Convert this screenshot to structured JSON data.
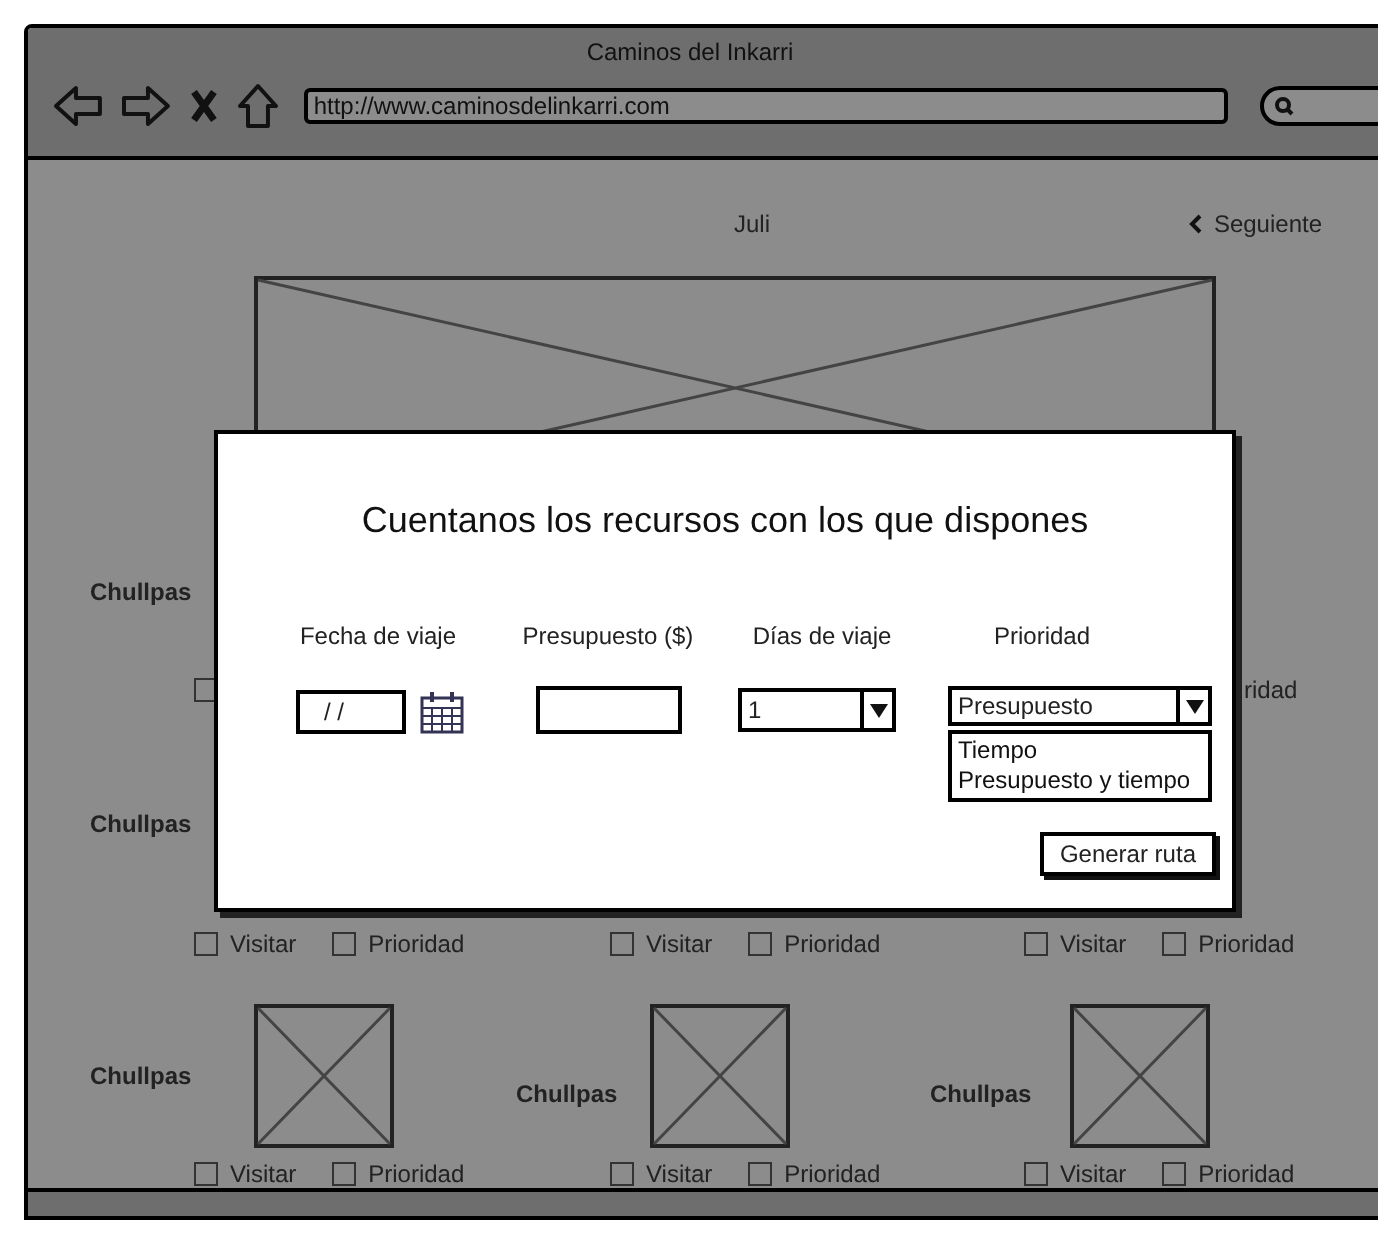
{
  "browser": {
    "title": "Caminos del Inkarri",
    "url": "http://www.caminosdelinkarri.com"
  },
  "header": {
    "month": "Juli",
    "next": "Seguiente"
  },
  "row_1": {
    "label": "Chullpas",
    "checkbox": {
      "checked": false
    },
    "cut_text": "ridad"
  },
  "row_2": [
    {
      "label": "Chullpas",
      "options": [
        {
          "label": "Visitar",
          "checked": false
        },
        {
          "label": "Prioridad",
          "checked": false
        }
      ]
    },
    {
      "options": [
        {
          "label": "Visitar",
          "checked": false
        },
        {
          "label": "Prioridad",
          "checked": false
        }
      ]
    },
    {
      "options": [
        {
          "label": "Visitar",
          "checked": false
        },
        {
          "label": "Prioridad",
          "checked": false
        }
      ]
    }
  ],
  "row_3": [
    {
      "label": "Chullpas",
      "options": [
        {
          "label": "Visitar",
          "checked": false
        },
        {
          "label": "Prioridad",
          "checked": false
        }
      ]
    },
    {
      "label": "Chullpas",
      "options": [
        {
          "label": "Visitar",
          "checked": false
        },
        {
          "label": "Prioridad",
          "checked": false
        }
      ]
    },
    {
      "label": "Chullpas",
      "options": [
        {
          "label": "Visitar",
          "checked": false
        },
        {
          "label": "Prioridad",
          "checked": false
        }
      ]
    }
  ],
  "dialog": {
    "title": "Cuentanos los recursos con los que dispones",
    "columns": [
      "Fecha de viaje",
      "Presupuesto ($)",
      "Días de viaje",
      "Prioridad"
    ],
    "date_value": "/ /",
    "days_value": "1",
    "priority_value": "Presupuesto",
    "priority_options": [
      {
        "label": "Tiempo",
        "selected": false
      },
      {
        "label": "Presupuesto y tiempo",
        "selected": false
      }
    ],
    "button": "Generar ruta"
  }
}
